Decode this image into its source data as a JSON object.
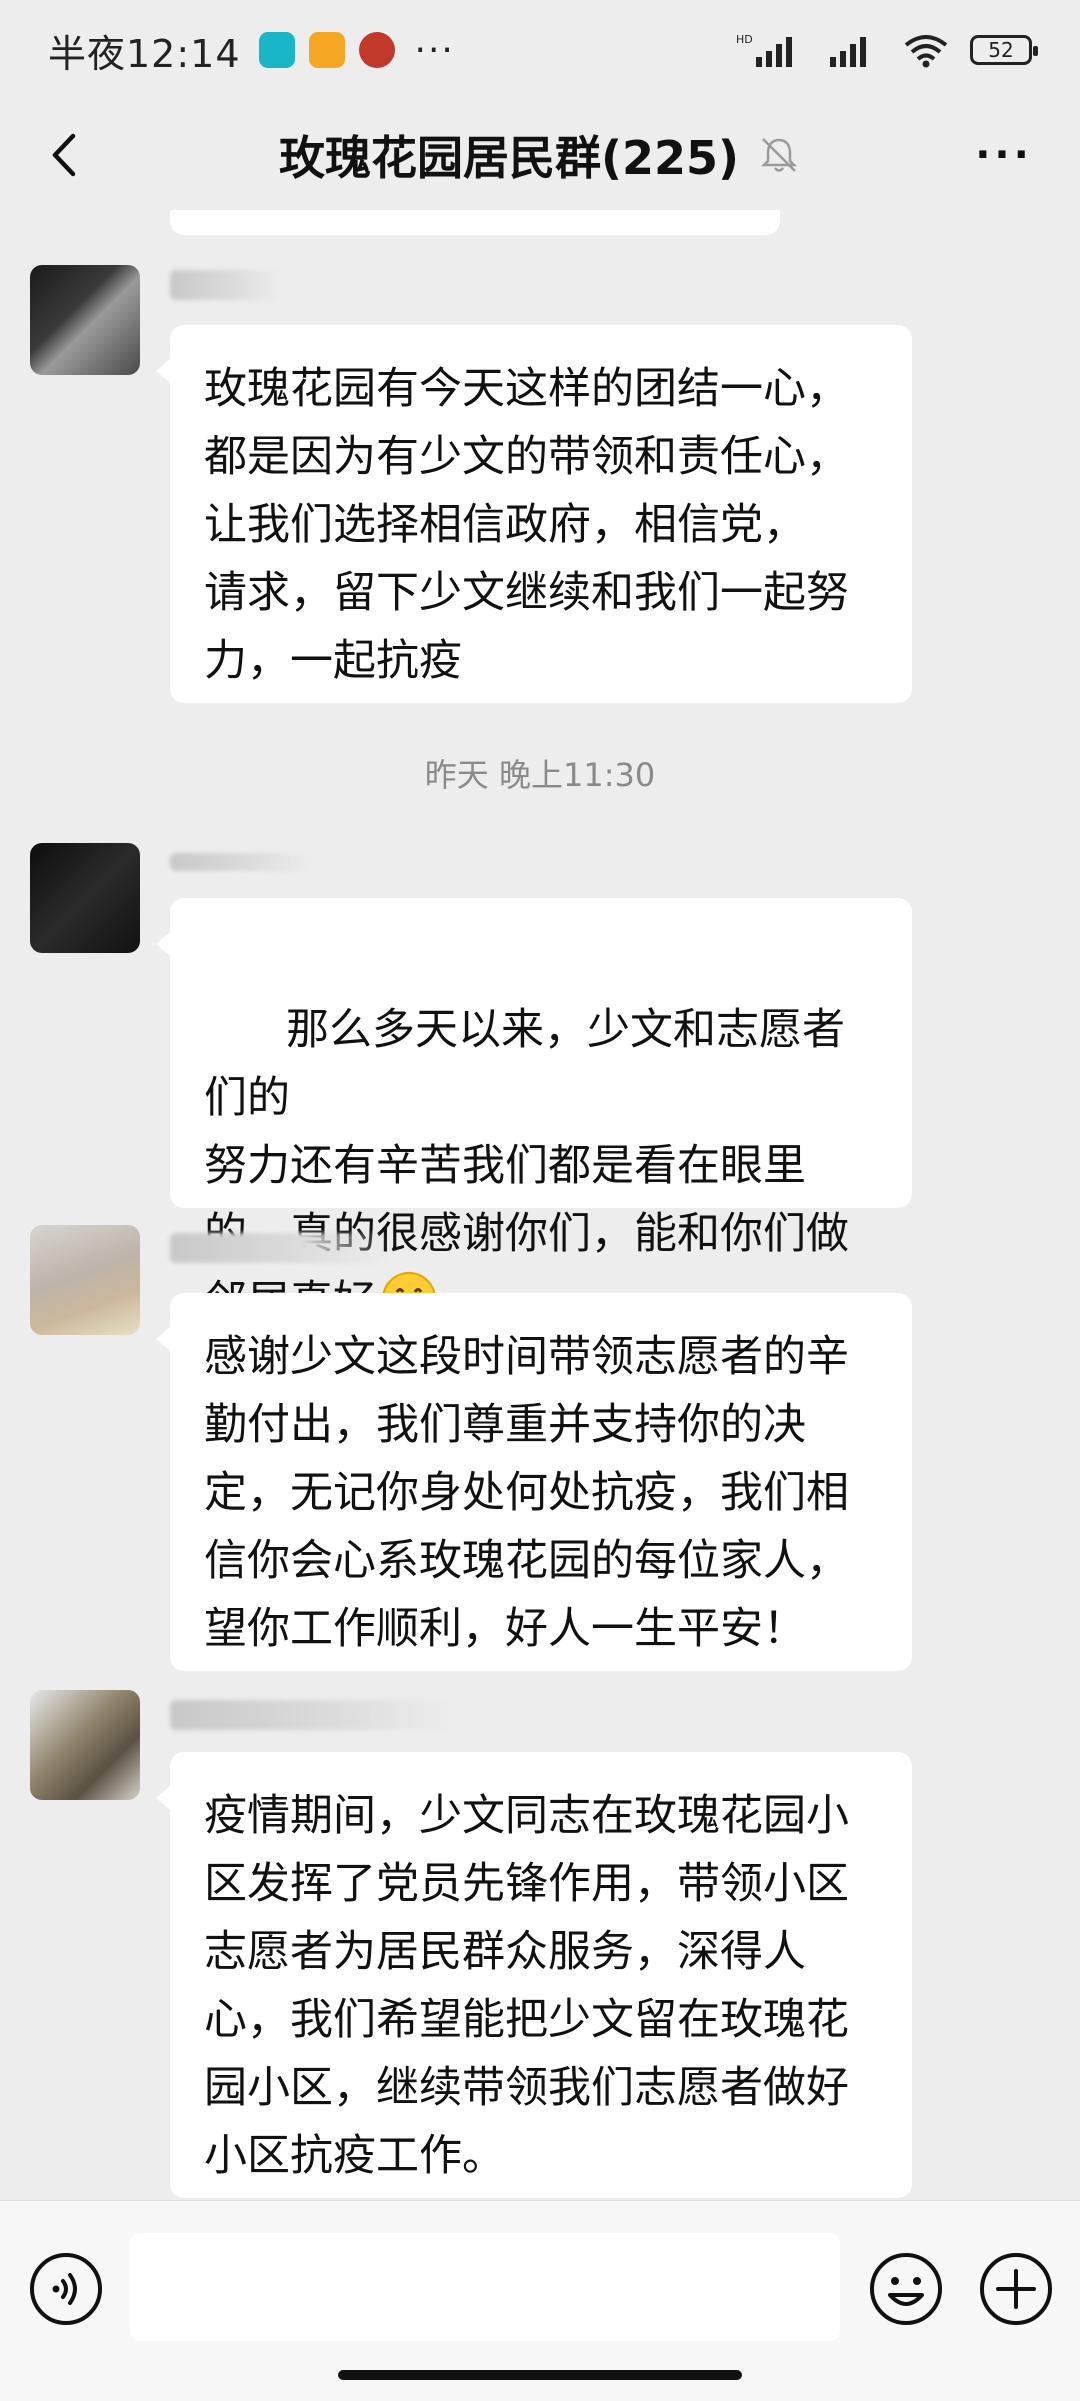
{
  "status": {
    "time": "半夜12:14",
    "more": "···",
    "battery": "52"
  },
  "header": {
    "title": "玫瑰花园居民群(225)",
    "more": "···"
  },
  "messages": [
    {
      "text": "玫瑰花园有今天这样的团结一心，\n都是因为有少文的带领和责任心，\n让我们选择相信政府，相信党，\n请求，留下少文继续和我们一起努\n力，一起抗疫"
    },
    {
      "text": "那么多天以来，少文和志愿者们的\n努力还有辛苦我们都是看在眼里\n的，真的很感谢你们，能和你们做\n邻居真好"
    },
    {
      "text": "感谢少文这段时间带领志愿者的辛\n勤付出，我们尊重并支持你的决\n定，无记你身处何处抗疫，我们相\n信你会心系玫瑰花园的每位家人，\n望你工作顺利，好人一生平安！"
    },
    {
      "text": "疫情期间，少文同志在玫瑰花园小\n区发挥了党员先锋作用，带领小区\n志愿者为居民群众服务，深得人\n心，我们希望能把少文留在玫瑰花\n园小区，继续带领我们志愿者做好\n小区抗疫工作。"
    }
  ],
  "timestamp": "昨天 晚上11:30",
  "input": {
    "placeholder": ""
  },
  "colors": {
    "background": "#ededed",
    "bubble": "#ffffff",
    "text": "#111111",
    "timestamp": "#8a8a8a"
  },
  "icons": [
    "back-arrow-icon",
    "mute-bell-icon",
    "voice-icon",
    "emoji-icon",
    "plus-icon",
    "grin-emoji-icon"
  ]
}
